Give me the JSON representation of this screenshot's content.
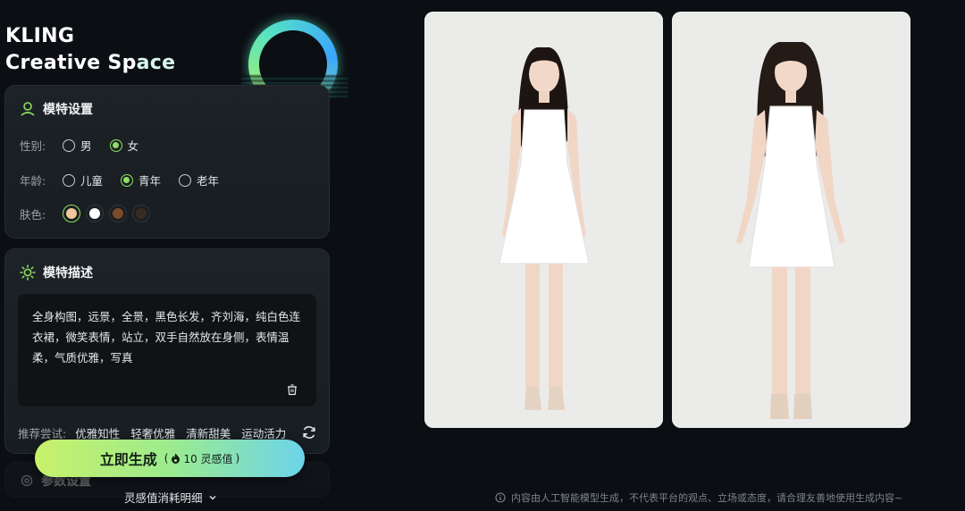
{
  "brand": {
    "line1": "KLING",
    "line2_a": "Creative Sp",
    "line2_b": "ace"
  },
  "model_settings": {
    "title": "模特设置",
    "gender": {
      "label": "性别:",
      "options": [
        "男",
        "女"
      ],
      "selected": "女"
    },
    "age": {
      "label": "年龄:",
      "options": [
        "儿童",
        "青年",
        "老年"
      ],
      "selected": "青年"
    },
    "skin": {
      "label": "肤色:",
      "colors": [
        "#f0c79a",
        "#ffffff",
        "#7a4a2a",
        "#3a2b22"
      ],
      "selected_index": 0
    }
  },
  "model_description": {
    "title": "模特描述",
    "text": "全身构图，远景，全景，黑色长发，齐刘海，纯白色连衣裙，微笑表情，站立，双手自然放在身侧，表情温柔，气质优雅，写真",
    "suggest_label": "推荐尝试:",
    "suggestions": [
      "优雅知性",
      "轻奢优雅",
      "清新甜美",
      "运动活力"
    ]
  },
  "params": {
    "title": "参数设置"
  },
  "generate": {
    "label": "立即生成",
    "cost_open": "(",
    "cost_value": "10 灵感值",
    "cost_close": ")"
  },
  "cost_detail": {
    "label": "灵感值消耗明细"
  },
  "disclaimer": "内容由人工智能模型生成，不代表平台的观点、立场或态度，请合理友善地使用生成内容~",
  "colors": {
    "accent": "#8ee061",
    "bg": "#0b0e12",
    "panel": "#1c2226"
  }
}
